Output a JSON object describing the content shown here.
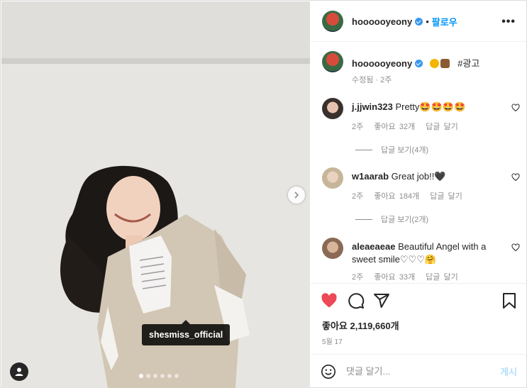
{
  "photo": {
    "tag_label": "shesmiss_official",
    "carousel_count": 6,
    "carousel_active": 1
  },
  "header": {
    "username": "hoooooyeony",
    "separator": "•",
    "follow_label": "팔로우",
    "more_label": "•••"
  },
  "caption": {
    "username": "hoooooyeony",
    "text": "#광고",
    "meta": "수정됨 · 2주"
  },
  "comments": [
    {
      "username": "j.jjwin323",
      "text": "Pretty🤩🤩🤩🤩",
      "time": "2주",
      "likes": "좋아요 32개",
      "reply": "답글 달기",
      "view_replies": "답글 보기(4개)"
    },
    {
      "username": "w1aarab",
      "text": "Great job!!🖤",
      "time": "2주",
      "likes": "좋아요 184개",
      "reply": "답글 달기",
      "view_replies": "답글 보기(2개)"
    },
    {
      "username": "aleaeaeae",
      "text": "Beautiful Angel with a sweet smile♡♡♡🤗",
      "time": "2주",
      "likes": "좋아요 33개",
      "reply": "답글 달기"
    }
  ],
  "likes": {
    "label": "좋아요 2,119,660개"
  },
  "date": "5월 17",
  "add_comment": {
    "placeholder": "댓글 달기...",
    "post_label": "게시"
  },
  "colors": {
    "like_red": "#ed4956",
    "link_blue": "#0095f6",
    "verified_blue": "#3897f0"
  }
}
